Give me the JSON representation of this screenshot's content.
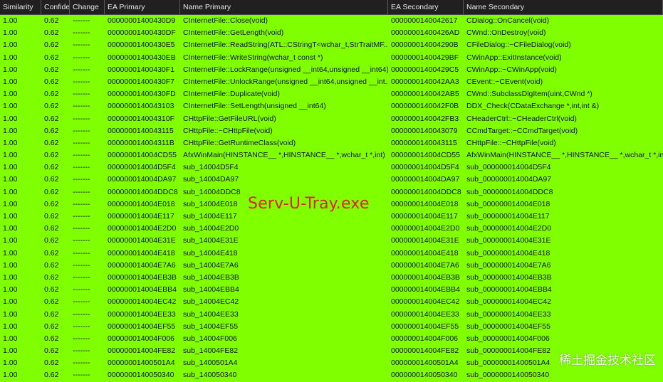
{
  "columns": [
    "Similarity",
    "Confide",
    "Change",
    "EA Primary",
    "Name Primary",
    "EA Secondary",
    "Name Secondary"
  ],
  "rows": [
    [
      "1.00",
      "0.62",
      "-------",
      "00000001400430D9",
      "CInternetFile::Close(void)",
      "0000000140042617",
      "CDialog::OnCancel(void)"
    ],
    [
      "1.00",
      "0.62",
      "-------",
      "00000001400430DF",
      "CInternetFile::GetLength(void)",
      "00000001400426AD",
      "CWnd::OnDestroy(void)"
    ],
    [
      "1.00",
      "0.62",
      "-------",
      "00000001400430E5",
      "CInternetFile::ReadString(ATL::CStringT<wchar_t,StrTraitMF...",
      "000000014004290B",
      "CFileDialog::~CFileDialog(void)"
    ],
    [
      "1.00",
      "0.62",
      "-------",
      "00000001400430EB",
      "CInternetFile::WriteString(wchar_t const *)",
      "00000001400429BF",
      "CWinApp::ExitInstance(void)"
    ],
    [
      "1.00",
      "0.62",
      "-------",
      "00000001400430F1",
      "CInternetFile::LockRange(unsigned __int64,unsigned __int64)",
      "00000001400429C5",
      "CWinApp::~CWinApp(void)"
    ],
    [
      "1.00",
      "0.62",
      "-------",
      "00000001400430F7",
      "CInternetFile::UnlockRange(unsigned __int64,unsigned __int...",
      "0000000140042AA3",
      "CEvent::~CEvent(void)"
    ],
    [
      "1.00",
      "0.62",
      "-------",
      "00000001400430FD",
      "CInternetFile::Duplicate(void)",
      "0000000140042AB5",
      "CWnd::SubclassDlgItem(uint,CWnd *)"
    ],
    [
      "1.00",
      "0.62",
      "-------",
      "0000000140043103",
      "CInternetFile::SetLength(unsigned __int64)",
      "0000000140042F0B",
      "DDX_Check(CDataExchange *,int,int &)"
    ],
    [
      "1.00",
      "0.62",
      "-------",
      "000000014004310F",
      "CHttpFile::GetFileURL(void)",
      "0000000140042FB3",
      "CHeaderCtrl::~CHeaderCtrl(void)"
    ],
    [
      "1.00",
      "0.62",
      "-------",
      "0000000140043115",
      "CHttpFile::~CHttpFile(void)",
      "0000000140043079",
      "CCmdTarget::~CCmdTarget(void)"
    ],
    [
      "1.00",
      "0.62",
      "-------",
      "000000014004311B",
      "CHttpFile::GetRuntimeClass(void)",
      "0000000140043115",
      "CHttpFile::~CHttpFile(void)"
    ],
    [
      "1.00",
      "0.62",
      "-------",
      "000000014004CD55",
      "AfxWinMain(HINSTANCE__ *,HINSTANCE__ *,wchar_t *,int)",
      "000000014004CD55",
      "AfxWinMain(HINSTANCE__ *,HINSTANCE__ *,wchar_t *,int)"
    ],
    [
      "1.00",
      "0.62",
      "-------",
      "000000014004D5F4",
      "sub_14004D5F4",
      "000000014004D5F4",
      "sub_000000014004D5F4"
    ],
    [
      "1.00",
      "0.62",
      "-------",
      "000000014004DA97",
      "sub_14004DA97",
      "000000014004DA97",
      "sub_000000014004DA97"
    ],
    [
      "1.00",
      "0.62",
      "-------",
      "000000014004DDC8",
      "sub_14004DDC8",
      "000000014004DDC8",
      "sub_000000014004DDC8"
    ],
    [
      "1.00",
      "0.62",
      "-------",
      "000000014004E018",
      "sub_14004E018",
      "000000014004E018",
      "sub_000000014004E018"
    ],
    [
      "1.00",
      "0.62",
      "-------",
      "000000014004E117",
      "sub_14004E117",
      "000000014004E117",
      "sub_000000014004E117"
    ],
    [
      "1.00",
      "0.62",
      "-------",
      "000000014004E2D0",
      "sub_14004E2D0",
      "000000014004E2D0",
      "sub_000000014004E2D0"
    ],
    [
      "1.00",
      "0.62",
      "-------",
      "000000014004E31E",
      "sub_14004E31E",
      "000000014004E31E",
      "sub_000000014004E31E"
    ],
    [
      "1.00",
      "0.62",
      "-------",
      "000000014004E418",
      "sub_14004E418",
      "000000014004E418",
      "sub_000000014004E418"
    ],
    [
      "1.00",
      "0.62",
      "-------",
      "000000014004E7A6",
      "sub_14004E7A6",
      "000000014004E7A6",
      "sub_000000014004E7A6"
    ],
    [
      "1.00",
      "0.62",
      "-------",
      "000000014004EB3B",
      "sub_14004EB3B",
      "000000014004EB3B",
      "sub_000000014004EB3B"
    ],
    [
      "1.00",
      "0.62",
      "-------",
      "000000014004EBB4",
      "sub_14004EBB4",
      "000000014004EBB4",
      "sub_000000014004EBB4"
    ],
    [
      "1.00",
      "0.62",
      "-------",
      "000000014004EC42",
      "sub_14004EC42",
      "000000014004EC42",
      "sub_000000014004EC42"
    ],
    [
      "1.00",
      "0.62",
      "-------",
      "000000014004EE33",
      "sub_14004EE33",
      "000000014004EE33",
      "sub_000000014004EE33"
    ],
    [
      "1.00",
      "0.62",
      "-------",
      "000000014004EF55",
      "sub_14004EF55",
      "000000014004EF55",
      "sub_000000014004EF55"
    ],
    [
      "1.00",
      "0.62",
      "-------",
      "000000014004F006",
      "sub_14004F006",
      "000000014004F006",
      "sub_000000014004F006"
    ],
    [
      "1.00",
      "0.62",
      "-------",
      "000000014004FE82",
      "sub_14004FE82",
      "000000014004FE82",
      "sub_000000014004FE82"
    ],
    [
      "1.00",
      "0.62",
      "-------",
      "00000001400501A4",
      "sub_1400501A4",
      "00000001400501A4",
      "sub_00000001400501A4"
    ],
    [
      "1.00",
      "0.62",
      "-------",
      "0000000140050340",
      "sub_140050340",
      "0000000140050340",
      "sub_0000000140050340"
    ]
  ],
  "overlay_label": "Serv-U-Tray.exe",
  "watermark": "稀土掘金技术社区",
  "colors": {
    "row_background": "#7fff00",
    "header_background": "#202020",
    "overlay_text": "#e0221b"
  }
}
